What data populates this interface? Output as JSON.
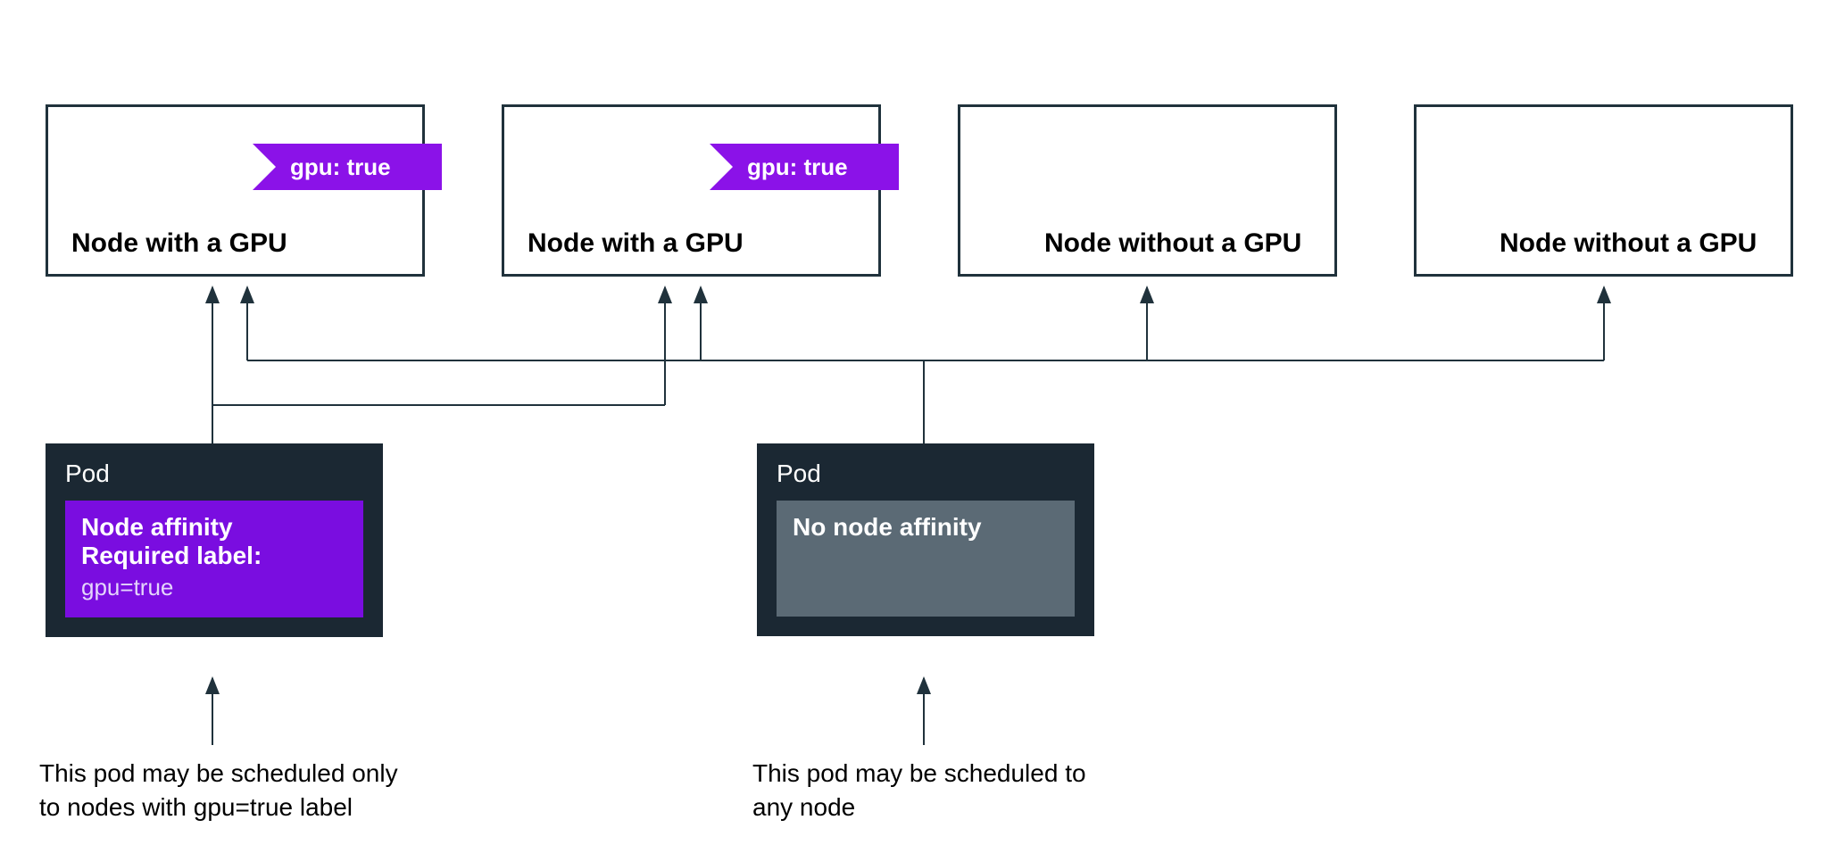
{
  "nodes": [
    {
      "label": "Node with a GPU",
      "gpu_tag": "gpu: true"
    },
    {
      "label": "Node with a GPU",
      "gpu_tag": "gpu: true"
    },
    {
      "label": "Node without a GPU",
      "gpu_tag": null
    },
    {
      "label": "Node without a GPU",
      "gpu_tag": null
    }
  ],
  "pods": [
    {
      "title": "Pod",
      "affinity_kind": "purple",
      "line1": "Node affinity",
      "line2": "Required label:",
      "line3": "gpu=true",
      "caption": "This pod may be scheduled only\nto nodes with gpu=true label"
    },
    {
      "title": "Pod",
      "affinity_kind": "grey",
      "line1": "No node affinity",
      "line2": "",
      "line3": "",
      "caption": "This pod may be scheduled to\nany node"
    }
  ],
  "colors": {
    "tag_bg": "#8b12e8",
    "pod_bg": "#1b2833",
    "affinity_purple": "#7a0de0",
    "affinity_grey": "#5b6a75",
    "border": "#20323c"
  }
}
